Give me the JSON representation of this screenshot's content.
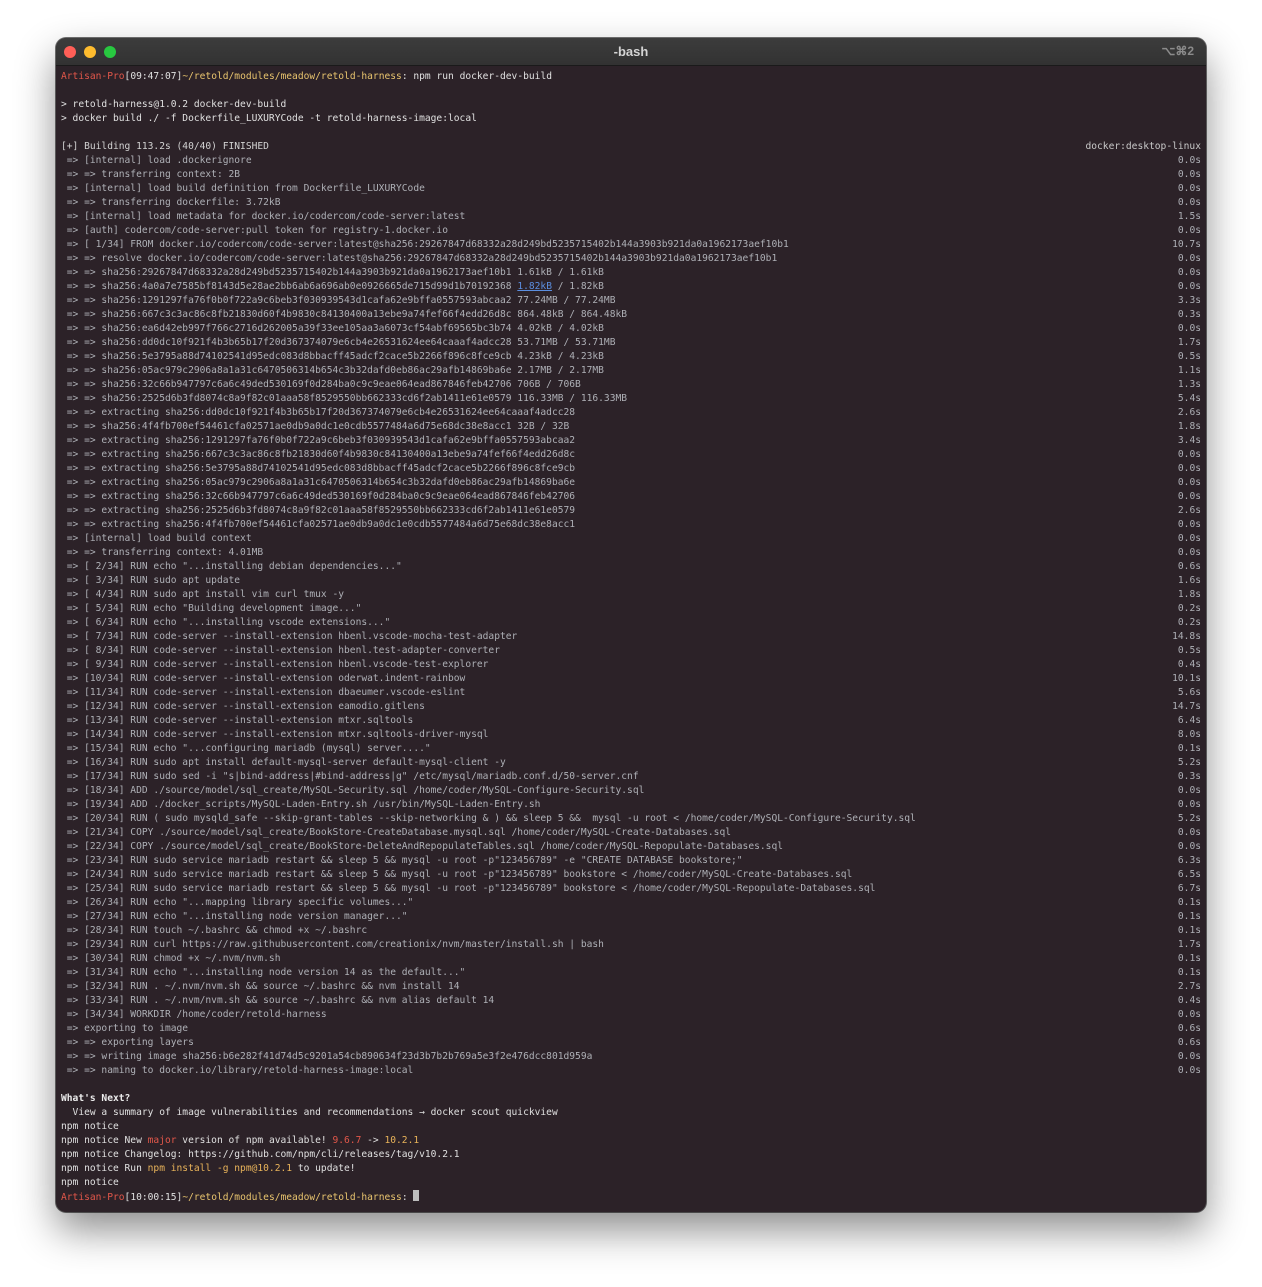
{
  "window": {
    "title": "-bash",
    "shortcut": "⌥⌘2"
  },
  "prompt1": {
    "host": "Artisan-Pro",
    "time": "[09:47:07]",
    "path": "~/retold/modules/meadow/retold-harness",
    "sep": ":",
    "command": " npm run docker-dev-build"
  },
  "script": {
    "line1": "> retold-harness@1.0.2 docker-dev-build",
    "line2": "> docker build ./ -f Dockerfile_LUXURYCode -t retold-harness-image:local"
  },
  "build": {
    "header": "[+] Building 113.2s (40/40) FINISHED",
    "header_right": "docker:desktop-linux",
    "steps": [
      {
        "text": " => [internal] load .dockerignore",
        "time": "0.0s"
      },
      {
        "text": " => => transferring context: 2B",
        "time": "0.0s"
      },
      {
        "text": " => [internal] load build definition from Dockerfile_LUXURYCode",
        "time": "0.0s"
      },
      {
        "text": " => => transferring dockerfile: 3.72kB",
        "time": "0.0s"
      },
      {
        "text": " => [internal] load metadata for docker.io/codercom/code-server:latest",
        "time": "1.5s"
      },
      {
        "text": " => [auth] codercom/code-server:pull token for registry-1.docker.io",
        "time": "0.0s"
      },
      {
        "text": " => [ 1/34] FROM docker.io/codercom/code-server:latest@sha256:29267847d68332a28d249bd5235715402b144a3903b921da0a1962173aef10b1",
        "time": "10.7s"
      },
      {
        "text": " => => resolve docker.io/codercom/code-server:latest@sha256:29267847d68332a28d249bd5235715402b144a3903b921da0a1962173aef10b1",
        "time": "0.0s"
      },
      {
        "text": " => => sha256:29267847d68332a28d249bd5235715402b144a3903b921da0a1962173aef10b1 1.61kB / 1.61kB",
        "time": "0.0s"
      },
      {
        "text": " => => sha256:4a0a7e7585bf8143d5e28ae2bb6ab6a696ab0e0926665de715d99d1b70192368 ",
        "link": "1.82kB",
        "tail": " / 1.82kB",
        "time": "0.0s"
      },
      {
        "text": " => => sha256:1291297fa76f0b0f722a9c6beb3f030939543d1cafa62e9bffa0557593abcaa2 77.24MB / 77.24MB",
        "time": "3.3s"
      },
      {
        "text": " => => sha256:667c3c3ac86c8fb21830d60f4b9830c84130400a13ebe9a74fef66f4edd26d8c 864.48kB / 864.48kB",
        "time": "0.3s"
      },
      {
        "text": " => => sha256:ea6d42eb997f766c2716d262005a39f33ee105aa3a6073cf54abf69565bc3b74 4.02kB / 4.02kB",
        "time": "0.0s"
      },
      {
        "text": " => => sha256:dd0dc10f921f4b3b65b17f20d367374079e6cb4e26531624ee64caaaf4adcc28 53.71MB / 53.71MB",
        "time": "1.7s"
      },
      {
        "text": " => => sha256:5e3795a88d74102541d95edc083d8bbacff45adcf2cace5b2266f896c8fce9cb 4.23kB / 4.23kB",
        "time": "0.5s"
      },
      {
        "text": " => => sha256:05ac979c2906a8a1a31c6470506314b654c3b32dafd0eb86ac29afb14869ba6e 2.17MB / 2.17MB",
        "time": "1.1s"
      },
      {
        "text": " => => sha256:32c66b947797c6a6c49ded530169f0d284ba0c9c9eae064ead867846feb42706 706B / 706B",
        "time": "1.3s"
      },
      {
        "text": " => => sha256:2525d6b3fd8074c8a9f82c01aaa58f8529550bb662333cd6f2ab1411e61e0579 116.33MB / 116.33MB",
        "time": "5.4s"
      },
      {
        "text": " => => extracting sha256:dd0dc10f921f4b3b65b17f20d367374079e6cb4e26531624ee64caaaf4adcc28",
        "time": "2.6s"
      },
      {
        "text": " => => sha256:4f4fb700ef54461cfa02571ae0db9a0dc1e0cdb5577484a6d75e68dc38e8acc1 32B / 32B",
        "time": "1.8s"
      },
      {
        "text": " => => extracting sha256:1291297fa76f0b0f722a9c6beb3f030939543d1cafa62e9bffa0557593abcaa2",
        "time": "3.4s"
      },
      {
        "text": " => => extracting sha256:667c3c3ac86c8fb21830d60f4b9830c84130400a13ebe9a74fef66f4edd26d8c",
        "time": "0.0s"
      },
      {
        "text": " => => extracting sha256:5e3795a88d74102541d95edc083d8bbacff45adcf2cace5b2266f896c8fce9cb",
        "time": "0.0s"
      },
      {
        "text": " => => extracting sha256:05ac979c2906a8a1a31c6470506314b654c3b32dafd0eb86ac29afb14869ba6e",
        "time": "0.0s"
      },
      {
        "text": " => => extracting sha256:32c66b947797c6a6c49ded530169f0d284ba0c9c9eae064ead867846feb42706",
        "time": "0.0s"
      },
      {
        "text": " => => extracting sha256:2525d6b3fd8074c8a9f82c01aaa58f8529550bb662333cd6f2ab1411e61e0579",
        "time": "2.6s"
      },
      {
        "text": " => => extracting sha256:4f4fb700ef54461cfa02571ae0db9a0dc1e0cdb5577484a6d75e68dc38e8acc1",
        "time": "0.0s"
      },
      {
        "text": " => [internal] load build context",
        "time": "0.0s"
      },
      {
        "text": " => => transferring context: 4.01MB",
        "time": "0.0s"
      },
      {
        "text": " => [ 2/34] RUN echo \"...installing debian dependencies...\"",
        "time": "0.6s"
      },
      {
        "text": " => [ 3/34] RUN sudo apt update",
        "time": "1.6s"
      },
      {
        "text": " => [ 4/34] RUN sudo apt install vim curl tmux -y",
        "time": "1.8s"
      },
      {
        "text": " => [ 5/34] RUN echo \"Building development image...\"",
        "time": "0.2s"
      },
      {
        "text": " => [ 6/34] RUN echo \"...installing vscode extensions...\"",
        "time": "0.2s"
      },
      {
        "text": " => [ 7/34] RUN code-server --install-extension hbenl.vscode-mocha-test-adapter",
        "time": "14.8s"
      },
      {
        "text": " => [ 8/34] RUN code-server --install-extension hbenl.test-adapter-converter",
        "time": "0.5s"
      },
      {
        "text": " => [ 9/34] RUN code-server --install-extension hbenl.vscode-test-explorer",
        "time": "0.4s"
      },
      {
        "text": " => [10/34] RUN code-server --install-extension oderwat.indent-rainbow",
        "time": "10.1s"
      },
      {
        "text": " => [11/34] RUN code-server --install-extension dbaeumer.vscode-eslint",
        "time": "5.6s"
      },
      {
        "text": " => [12/34] RUN code-server --install-extension eamodio.gitlens",
        "time": "14.7s"
      },
      {
        "text": " => [13/34] RUN code-server --install-extension mtxr.sqltools",
        "time": "6.4s"
      },
      {
        "text": " => [14/34] RUN code-server --install-extension mtxr.sqltools-driver-mysql",
        "time": "8.0s"
      },
      {
        "text": " => [15/34] RUN echo \"...configuring mariadb (mysql) server....\"",
        "time": "0.1s"
      },
      {
        "text": " => [16/34] RUN sudo apt install default-mysql-server default-mysql-client -y",
        "time": "5.2s"
      },
      {
        "text": " => [17/34] RUN sudo sed -i \"s|bind-address|#bind-address|g\" /etc/mysql/mariadb.conf.d/50-server.cnf",
        "time": "0.3s"
      },
      {
        "text": " => [18/34] ADD ./source/model/sql_create/MySQL-Security.sql /home/coder/MySQL-Configure-Security.sql",
        "time": "0.0s"
      },
      {
        "text": " => [19/34] ADD ./docker_scripts/MySQL-Laden-Entry.sh /usr/bin/MySQL-Laden-Entry.sh",
        "time": "0.0s"
      },
      {
        "text": " => [20/34] RUN ( sudo mysqld_safe --skip-grant-tables --skip-networking & ) && sleep 5 &&  mysql -u root < /home/coder/MySQL-Configure-Security.sql",
        "time": "5.2s"
      },
      {
        "text": " => [21/34] COPY ./source/model/sql_create/BookStore-CreateDatabase.mysql.sql /home/coder/MySQL-Create-Databases.sql",
        "time": "0.0s"
      },
      {
        "text": " => [22/34] COPY ./source/model/sql_create/BookStore-DeleteAndRepopulateTables.sql /home/coder/MySQL-Repopulate-Databases.sql",
        "time": "0.0s"
      },
      {
        "text": " => [23/34] RUN sudo service mariadb restart && sleep 5 && mysql -u root -p\"123456789\" -e \"CREATE DATABASE bookstore;\"",
        "time": "6.3s"
      },
      {
        "text": " => [24/34] RUN sudo service mariadb restart && sleep 5 && mysql -u root -p\"123456789\" bookstore < /home/coder/MySQL-Create-Databases.sql",
        "time": "6.5s"
      },
      {
        "text": " => [25/34] RUN sudo service mariadb restart && sleep 5 && mysql -u root -p\"123456789\" bookstore < /home/coder/MySQL-Repopulate-Databases.sql",
        "time": "6.7s"
      },
      {
        "text": " => [26/34] RUN echo \"...mapping library specific volumes...\"",
        "time": "0.1s"
      },
      {
        "text": " => [27/34] RUN echo \"...installing node version manager...\"",
        "time": "0.1s"
      },
      {
        "text": " => [28/34] RUN touch ~/.bashrc && chmod +x ~/.bashrc",
        "time": "0.1s"
      },
      {
        "text": " => [29/34] RUN curl https://raw.githubusercontent.com/creationix/nvm/master/install.sh | bash",
        "time": "1.7s"
      },
      {
        "text": " => [30/34] RUN chmod +x ~/.nvm/nvm.sh",
        "time": "0.1s"
      },
      {
        "text": " => [31/34] RUN echo \"...installing node version 14 as the default...\"",
        "time": "0.1s"
      },
      {
        "text": " => [32/34] RUN . ~/.nvm/nvm.sh && source ~/.bashrc && nvm install 14",
        "time": "2.7s"
      },
      {
        "text": " => [33/34] RUN . ~/.nvm/nvm.sh && source ~/.bashrc && nvm alias default 14",
        "time": "0.4s"
      },
      {
        "text": " => [34/34] WORKDIR /home/coder/retold-harness",
        "time": "0.0s"
      },
      {
        "text": " => exporting to image",
        "time": "0.6s"
      },
      {
        "text": " => => exporting layers",
        "time": "0.6s"
      },
      {
        "text": " => => writing image sha256:b6e282f41d74d5c9201a54cb890634f23d3b7b2b769a5e3f2e476dcc801d959a",
        "time": "0.0s"
      },
      {
        "text": " => => naming to docker.io/library/retold-harness-image:local",
        "time": "0.0s"
      }
    ]
  },
  "next": {
    "heading": "What's Next?",
    "summary": "  View a summary of image vulnerabilities and recommendations → docker scout quickview"
  },
  "npm": {
    "notice1": "npm notice",
    "new_prefix": "npm notice New ",
    "major": "major",
    "new_mid": " version of npm available! ",
    "old_version": "9.6.7",
    "arrow": " -> ",
    "new_version": "10.2.1",
    "changelog": "npm notice Changelog: https://github.com/npm/cli/releases/tag/v10.2.1",
    "run_prefix": "npm notice Run ",
    "run_cmd": "npm install -g npm@10.2.1",
    "run_suffix": " to update!",
    "notice2": "npm notice"
  },
  "prompt2": {
    "host": "Artisan-Pro",
    "time": "[10:00:15]",
    "path": "~/retold/modules/meadow/retold-harness",
    "sep": ": "
  }
}
